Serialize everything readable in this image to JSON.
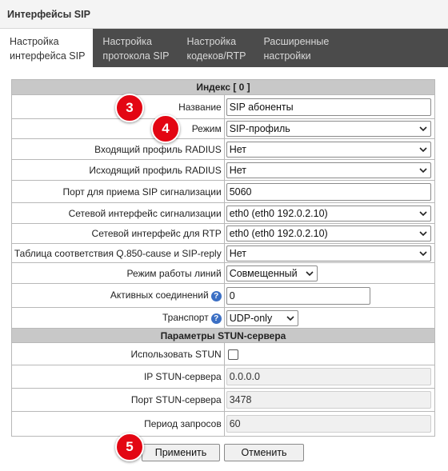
{
  "window": {
    "title": "Интерфейсы SIP"
  },
  "tabs": [
    {
      "line1": "Настройка",
      "line2": "интерфейса SIP",
      "active": true
    },
    {
      "line1": "Настройка",
      "line2": "протокола SIP",
      "active": false
    },
    {
      "line1": "Настройка",
      "line2": "кодеков/RTP",
      "active": false
    },
    {
      "line1": "Расширенные",
      "line2": "настройки",
      "active": false
    }
  ],
  "form": {
    "index_header": "Индекс [ 0 ]",
    "name": {
      "label": "Название",
      "value": "SIP абоненты"
    },
    "mode": {
      "label": "Режим",
      "value": "SIP-профиль"
    },
    "radius_in": {
      "label": "Входящий профиль RADIUS",
      "value": "Нет"
    },
    "radius_out": {
      "label": "Исходящий профиль RADIUS",
      "value": "Нет"
    },
    "sip_port": {
      "label": "Порт для приема SIP сигнализации",
      "value": "5060"
    },
    "sig_iface": {
      "label": "Сетевой интерфейс сигнализации",
      "value": "eth0 (eth0 192.0.2.10)"
    },
    "rtp_iface": {
      "label": "Сетевой интерфейс для RTP",
      "value": "eth0 (eth0 192.0.2.10)"
    },
    "q850_table": {
      "label": "Таблица соответствия Q.850-cause и SIP-reply",
      "value": "Нет"
    },
    "line_mode": {
      "label": "Режим работы линий",
      "value": "Совмещенный"
    },
    "active_conn": {
      "label": "Активных соединений",
      "value": "0"
    },
    "transport": {
      "label": "Транспорт",
      "value": "UDP-only"
    },
    "help_glyph": "?",
    "stun_header": "Параметры STUN-сервера",
    "use_stun": {
      "label": "Использовать STUN",
      "checked": false
    },
    "stun_ip": {
      "label": "IP STUN-сервера",
      "value": "0.0.0.0"
    },
    "stun_port": {
      "label": "Порт STUN-сервера",
      "value": "3478"
    },
    "stun_period": {
      "label": "Период запросов",
      "value": "60"
    }
  },
  "buttons": {
    "apply": "Применить",
    "cancel": "Отменить"
  },
  "badges": {
    "b3": "3",
    "b4": "4",
    "b5": "5"
  },
  "colors": {
    "badge": "#e30613",
    "tabbar": "#4b4b4b",
    "section": "#c8c8c8"
  }
}
